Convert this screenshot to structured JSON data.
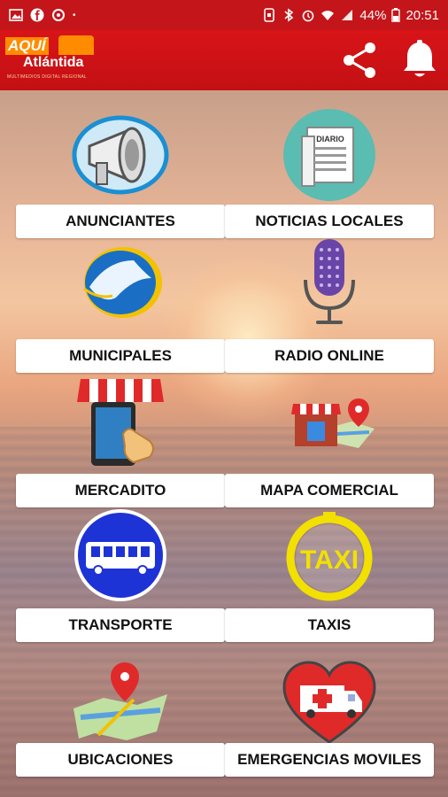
{
  "status_bar": {
    "battery": "44%",
    "time": "20:51"
  },
  "app_bar": {
    "logo_main": "AQUÍ",
    "logo_sub": "Atlántida",
    "logo_tagline": "MULTIMEDIOS DIGITAL REGIONAL"
  },
  "tiles": [
    {
      "label": "ANUNCIANTES",
      "icon": "megaphone-icon"
    },
    {
      "label": "NOTICIAS LOCALES",
      "icon": "newspaper-icon",
      "icon_text": "DIARIO"
    },
    {
      "label": "MUNICIPALES",
      "icon": "municipal-logo-icon"
    },
    {
      "label": "RADIO ONLINE",
      "icon": "microphone-icon"
    },
    {
      "label": "MERCADITO",
      "icon": "shop-phone-icon"
    },
    {
      "label": "MAPA COMERCIAL",
      "icon": "store-map-icon"
    },
    {
      "label": "TRANSPORTE",
      "icon": "bus-icon"
    },
    {
      "label": "TAXIS",
      "icon": "taxi-icon",
      "icon_text": "TAXI"
    },
    {
      "label": "UBICACIONES",
      "icon": "map-pin-icon"
    },
    {
      "label": "EMERGENCIAS MOVILES",
      "icon": "ambulance-heart-icon"
    }
  ],
  "colors": {
    "app_bar": "#c4151a",
    "accent": "#ff8c00"
  }
}
